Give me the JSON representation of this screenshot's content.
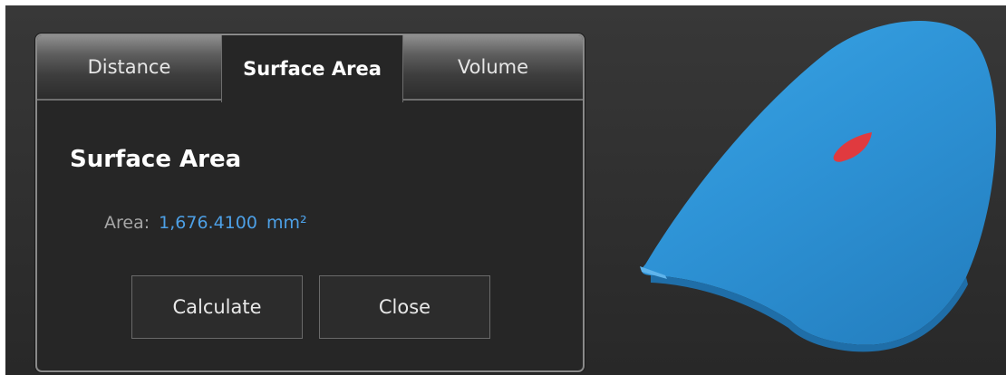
{
  "tabs": [
    {
      "label": "Distance",
      "active": false
    },
    {
      "label": "Surface Area",
      "active": true
    },
    {
      "label": "Volume",
      "active": false
    }
  ],
  "panel": {
    "title": "Surface Area",
    "area_label": "Area:",
    "area_value": "1,676.4100",
    "area_unit": "mm²"
  },
  "buttons": {
    "calculate": "Calculate",
    "close": "Close"
  },
  "colors": {
    "model": "#2e8fd3",
    "selected_region": "#e03a3f",
    "value_text": "#4da0e6"
  }
}
